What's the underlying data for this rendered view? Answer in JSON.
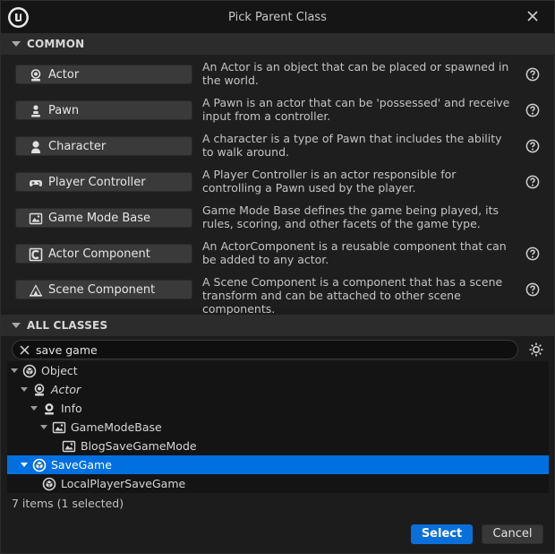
{
  "window": {
    "title": "Pick Parent Class"
  },
  "common": {
    "header": "COMMON",
    "items": [
      {
        "label": "Actor",
        "icon": "actor-icon",
        "description": "An Actor is an object that can be placed or spawned in the world.",
        "help": true
      },
      {
        "label": "Pawn",
        "icon": "pawn-icon",
        "description": "A Pawn is an actor that can be 'possessed' and receive input from a controller.",
        "help": true
      },
      {
        "label": "Character",
        "icon": "character-icon",
        "description": "A character is a type of Pawn that includes the ability to walk around.",
        "help": true
      },
      {
        "label": "Player Controller",
        "icon": "gamepad-icon",
        "description": "A Player Controller is an actor responsible for controlling a Pawn used by the player.",
        "help": true
      },
      {
        "label": "Game Mode Base",
        "icon": "game-mode-icon",
        "description": "Game Mode Base defines the game being played, its rules, scoring, and other facets of the game type.",
        "help": false
      },
      {
        "label": "Actor Component",
        "icon": "actor-component-icon",
        "description": "An ActorComponent is a reusable component that can be added to any actor.",
        "help": true
      },
      {
        "label": "Scene Component",
        "icon": "scene-component-icon",
        "description": "A Scene Component is a component that has a scene transform and can be attached to other scene components.",
        "help": true
      }
    ]
  },
  "all_classes": {
    "header": "ALL CLASSES",
    "search": {
      "value": "save game"
    },
    "tree": [
      {
        "label": "Object",
        "icon": "object-icon",
        "depth": 0,
        "expanded": true,
        "italic": false,
        "selected": false
      },
      {
        "label": "Actor",
        "icon": "actor-icon",
        "depth": 1,
        "expanded": true,
        "italic": true,
        "selected": false
      },
      {
        "label": "Info",
        "icon": "info-icon",
        "depth": 2,
        "expanded": true,
        "italic": false,
        "selected": false
      },
      {
        "label": "GameModeBase",
        "icon": "game-mode-icon",
        "depth": 3,
        "expanded": true,
        "italic": false,
        "selected": false
      },
      {
        "label": "BlogSaveGameMode",
        "icon": "game-mode-icon",
        "depth": 4,
        "expanded": false,
        "italic": false,
        "selected": false
      },
      {
        "label": "SaveGame",
        "icon": "object-icon",
        "depth": 1,
        "expanded": true,
        "italic": false,
        "selected": true
      },
      {
        "label": "LocalPlayerSaveGame",
        "icon": "object-icon",
        "depth": 2,
        "expanded": false,
        "italic": false,
        "selected": false
      }
    ],
    "status": "7 items (1 selected)"
  },
  "footer": {
    "select_label": "Select",
    "cancel_label": "Cancel"
  },
  "colors": {
    "accent": "#0070e0",
    "background": "#1c1c1c"
  }
}
